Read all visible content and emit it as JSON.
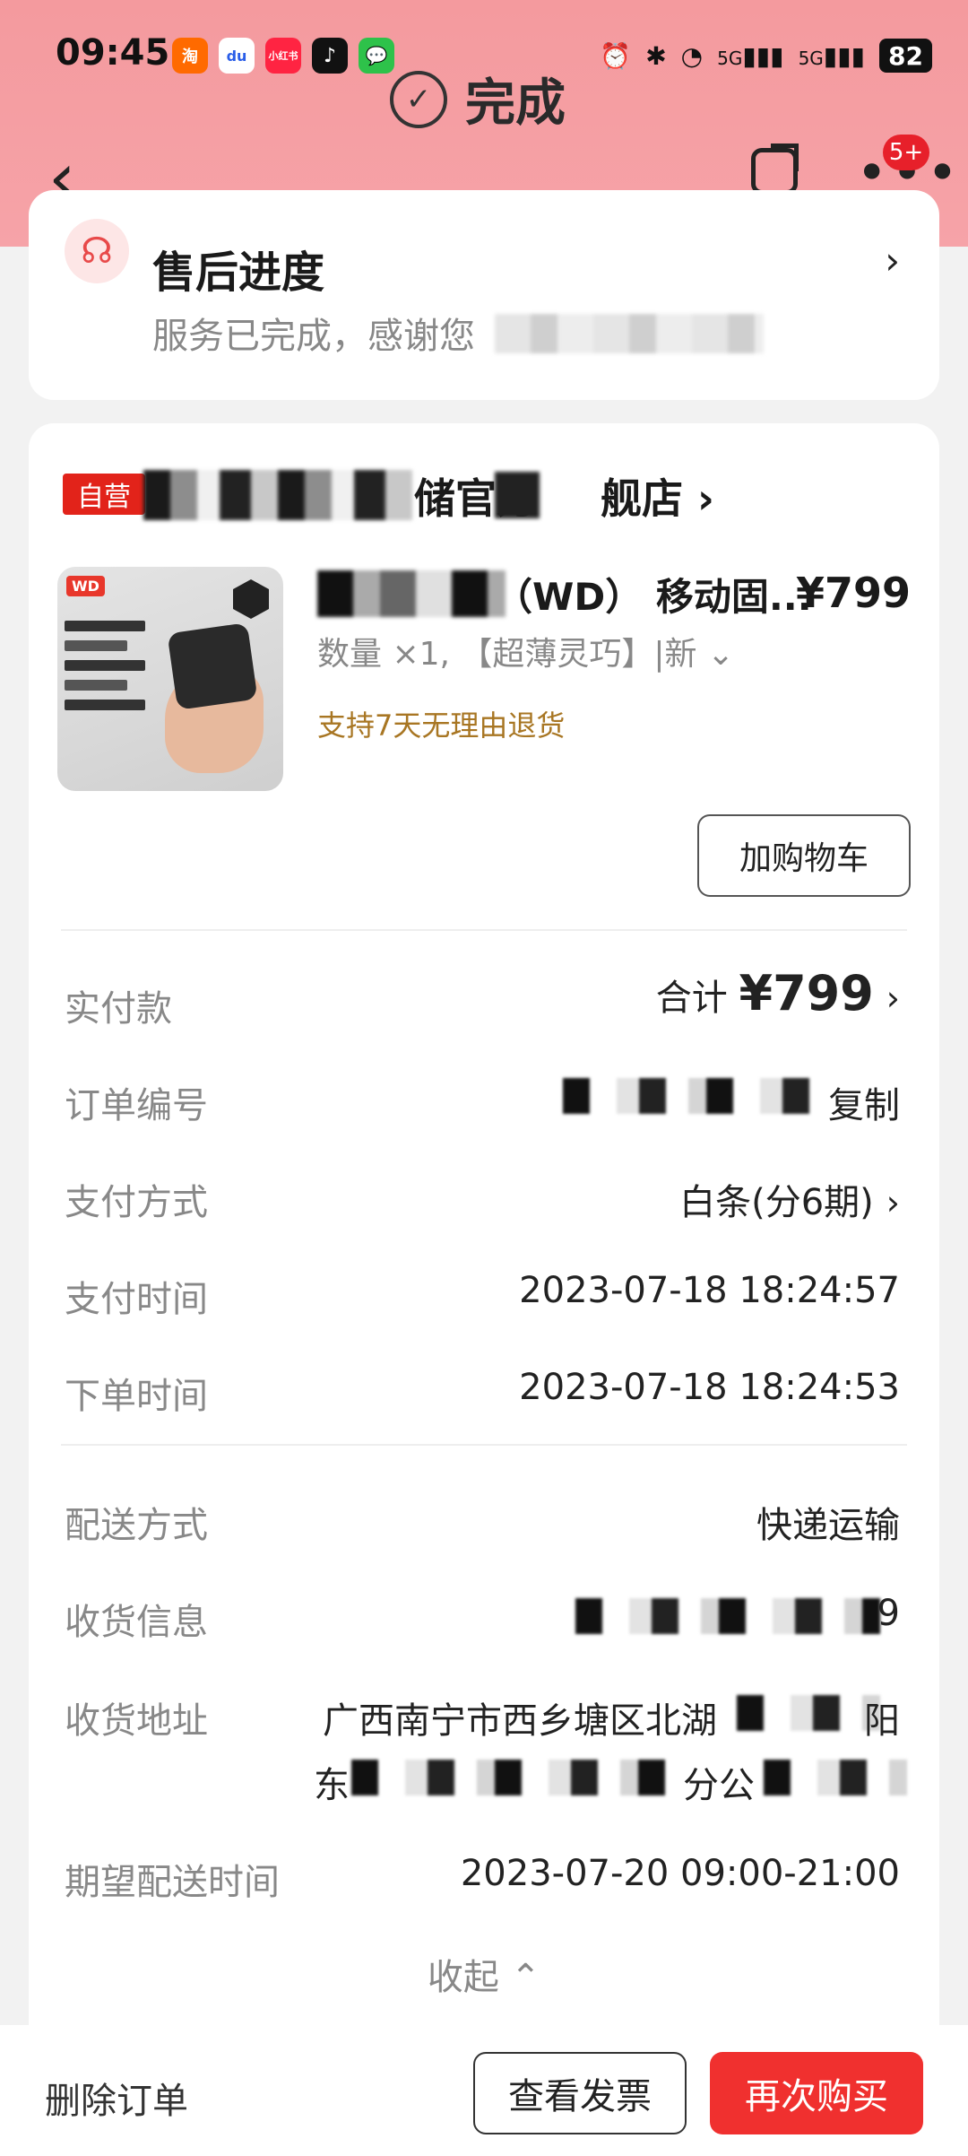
{
  "status_bar": {
    "time": "09:45",
    "apps": [
      "淘",
      "du",
      "小红书",
      "♪",
      "💬"
    ],
    "signal1": "5G",
    "signal2": "5G",
    "battery": "82"
  },
  "header": {
    "status_title": "完成",
    "back": "‹",
    "more_badge": "5+"
  },
  "after_sale": {
    "title": "售后进度",
    "subtitle": "服务已完成，感谢您"
  },
  "store": {
    "tag": "自营",
    "name_fragment": "储官方",
    "name_tail": "舰店 ›"
  },
  "product": {
    "title_fragment": "（WD） 移动固...",
    "price": "¥799",
    "spec": "数量 ×1, 【超薄灵巧】|新 ⌄",
    "return_policy": "支持7天无理由退货",
    "add_cart": "加购物车",
    "image_logo": "WD"
  },
  "order_info": {
    "paid_label": "实付款",
    "paid_prefix": "合计",
    "paid_amount": "¥799",
    "order_no_label": "订单编号",
    "copy": "复制",
    "pay_method_label": "支付方式",
    "pay_method": "白条(分6期)",
    "pay_time_label": "支付时间",
    "pay_time": "2023-07-18 18:24:57",
    "order_time_label": "下单时间",
    "order_time": "2023-07-18 18:24:53",
    "delivery_label": "配送方式",
    "delivery": "快递运输",
    "receiver_label": "收货信息",
    "receiver_tail": "9",
    "address_label": "收货地址",
    "address_line1": "广西南宁市西乡塘区北湖",
    "address_line1_tail": "阳",
    "address_line2_a": "东",
    "address_line2_b": "分公",
    "expected_label": "期望配送时间",
    "expected": "2023-07-20 09:00-21:00",
    "collapse": "收起 ⌃"
  },
  "bottom_bar": {
    "delete": "删除订单",
    "invoice": "查看发票",
    "rebuy": "再次购买"
  }
}
